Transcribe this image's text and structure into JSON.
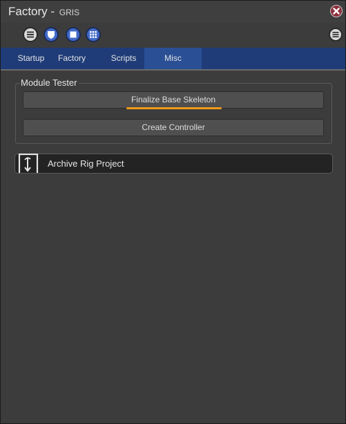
{
  "window": {
    "title": "Factory - ",
    "subtitle": "GRIS"
  },
  "toolbar": {
    "icons": [
      "menu-icon",
      "shield-icon",
      "stop-icon",
      "grid-icon"
    ],
    "right_icon": "menu-icon"
  },
  "tabs": [
    {
      "label": "Startup",
      "active": false
    },
    {
      "label": "Factory",
      "active": false
    },
    {
      "label": "Scripts",
      "active": false
    },
    {
      "label": "Misc",
      "active": true
    }
  ],
  "module_tester": {
    "title": "Module Tester",
    "buttons": [
      {
        "label": "Finalize Base Skeleton",
        "highlighted": true
      },
      {
        "label": "Create Controller",
        "highlighted": false
      }
    ]
  },
  "archive": {
    "label": "Archive Rig Project"
  },
  "colors": {
    "accent_tab": "#2a4f95",
    "tabbar": "#1f3c78",
    "highlight": "#f39a16",
    "close": "#8e2f3c"
  }
}
